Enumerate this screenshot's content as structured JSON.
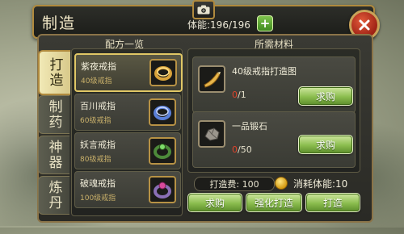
{
  "header": {
    "title": "制造",
    "stamina_label": "体能:",
    "stamina_value": "196/196",
    "plus_icon": "plus-icon",
    "camera_icon": "camera-icon",
    "close_icon": "close-icon"
  },
  "tabs": [
    {
      "label": "打造",
      "active": true
    },
    {
      "label": "制药",
      "active": false
    },
    {
      "label": "神器",
      "active": false
    },
    {
      "label": "炼丹",
      "active": false
    }
  ],
  "recipes": {
    "title": "配方一览",
    "items": [
      {
        "name": "紫夜戒指",
        "level": "40级戒指",
        "icon": "gold-ring-icon",
        "selected": true
      },
      {
        "name": "百川戒指",
        "level": "60级戒指",
        "icon": "blue-ring-icon",
        "selected": false
      },
      {
        "name": "妖言戒指",
        "level": "80级戒指",
        "icon": "green-ring-icon",
        "selected": false
      },
      {
        "name": "破魂戒指",
        "level": "100级戒指",
        "icon": "purple-ring-icon",
        "selected": false
      }
    ]
  },
  "materials": {
    "title": "所需材料",
    "items": [
      {
        "name": "40级戒指打造图",
        "have": "0",
        "need": "/1",
        "icon": "horn-blueprint-icon",
        "button": "求购"
      },
      {
        "name": "一品锻石",
        "have": "0",
        "need": "/50",
        "icon": "ore-stone-icon",
        "button": "求购"
      }
    ]
  },
  "cost": {
    "fee": "打造费: 100",
    "coin_icon": "gold-coin-icon",
    "stamina_cost": "消耗体能:10"
  },
  "actions": {
    "buy": "求购",
    "enhance": "强化打造",
    "forge": "打造"
  },
  "colors": {
    "accent_gold": "#b08a3e",
    "button_green": "#8bbd4e",
    "missing_red": "#e0442c",
    "close_red": "#c23a22"
  }
}
